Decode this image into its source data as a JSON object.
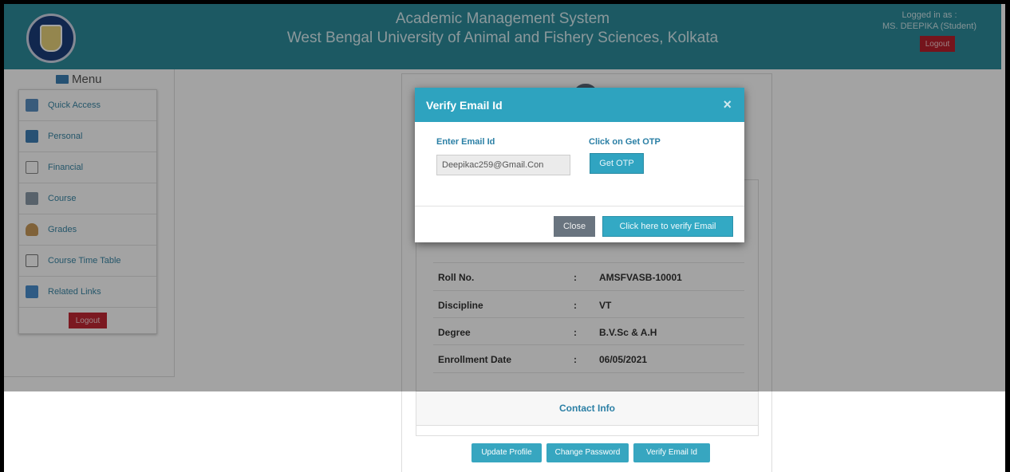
{
  "header": {
    "app_title": "Academic Management System",
    "university": "West Bengal University of Animal and Fishery Sciences, Kolkata",
    "logged_label": "Logged in as :",
    "logged_user": "MS. DEEPIKA (Student)",
    "logout_label": "Logout",
    "color": "#2d8c9c"
  },
  "sidebar": {
    "title": "Menu",
    "items": [
      {
        "label": "Quick Access",
        "icon": "laptop-icon",
        "color": "#5a8fc0"
      },
      {
        "label": "Personal",
        "icon": "user-card-icon",
        "color": "#3f7fb6"
      },
      {
        "label": "Financial",
        "icon": "home-icon",
        "color": "#888888"
      },
      {
        "label": "Course",
        "icon": "document-icon",
        "color": "#8a9aa8"
      },
      {
        "label": "Grades",
        "icon": "person-icon",
        "color": "#c89a5a"
      },
      {
        "label": "Course Time Table",
        "icon": "timetable-icon",
        "color": "#777777"
      },
      {
        "label": "Related Links",
        "icon": "links-icon",
        "color": "#4a8fcf"
      }
    ],
    "logout_label": "Logout"
  },
  "profile": {
    "rows": [
      {
        "key": "Roll No.",
        "sep": ":",
        "value": "AMSFVASB-10001"
      },
      {
        "key": "Discipline",
        "sep": ":",
        "value": "VT"
      },
      {
        "key": "Degree",
        "sep": ":",
        "value": "B.V.Sc & A.H"
      },
      {
        "key": "Enrollment Date",
        "sep": ":",
        "value": "06/05/2021"
      }
    ],
    "contact_title": "Contact Info",
    "buttons": {
      "update_profile": "Update Profile",
      "change_password": "Change Password",
      "verify_email": "Verify Email Id"
    }
  },
  "modal": {
    "title": "Verify Email Id",
    "close_symbol": "×",
    "email_label": "Enter Email Id",
    "email_value": "Deepikac259@Gmail.Con",
    "otp_label": "Click on Get OTP",
    "get_otp_label": "Get OTP",
    "close_label": "Close",
    "verify_label": "Click here to verify Email",
    "accent": "#2ea3bf"
  }
}
